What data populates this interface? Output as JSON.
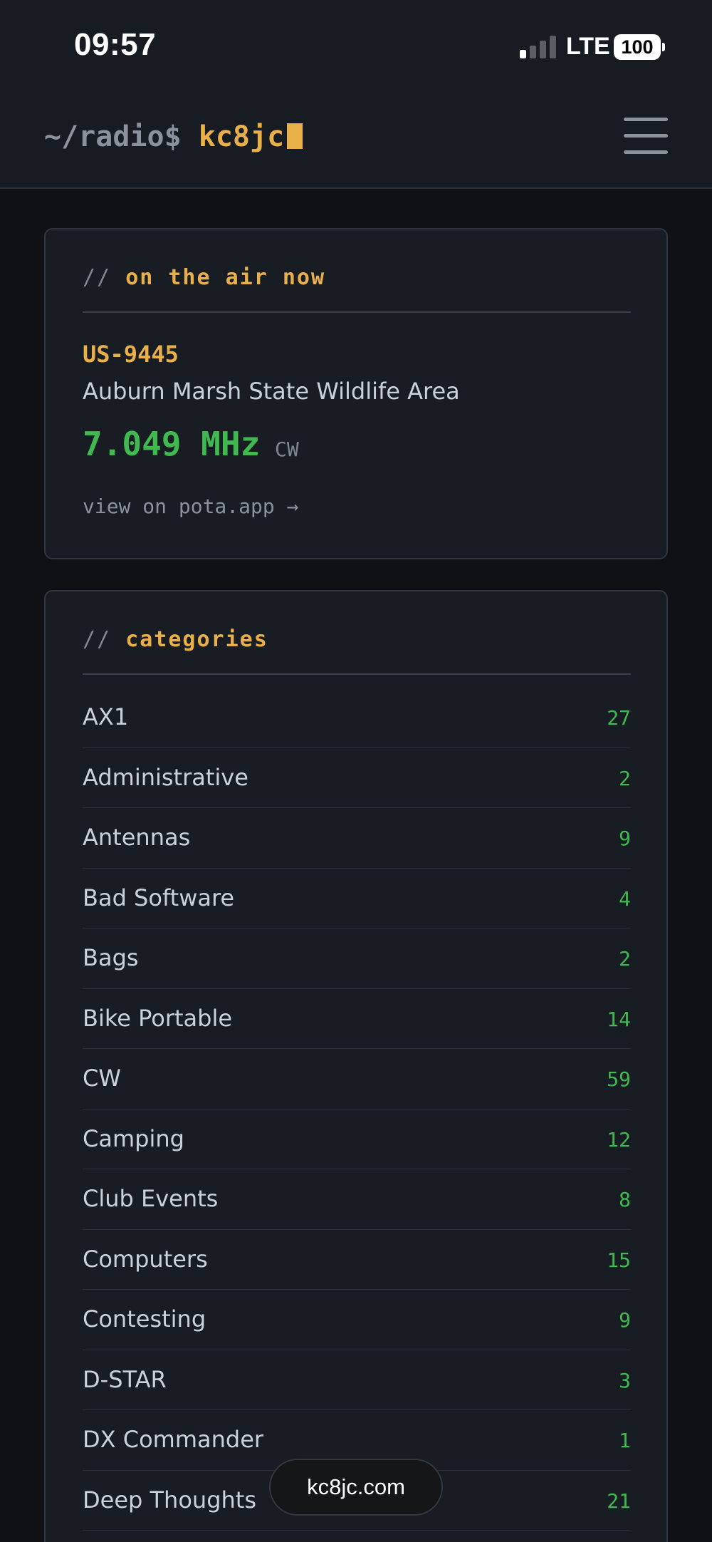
{
  "status_bar": {
    "time": "09:57",
    "network": "LTE",
    "battery": "100",
    "signal_bars_on": 1,
    "signal_bars_total": 4
  },
  "header": {
    "prompt": "~/radio$",
    "host": "kc8jc",
    "menu_icon": "hamburger-menu-icon"
  },
  "on_air": {
    "slashes": "//",
    "title": "on the air now",
    "park_ref": "US-9445",
    "park_name": "Auburn Marsh State Wildlife Area",
    "frequency": "7.049 MHz",
    "mode": "CW",
    "link_text": "view on pota.app →"
  },
  "categories": {
    "slashes": "//",
    "title": "categories",
    "items": [
      {
        "name": "AX1",
        "count": "27"
      },
      {
        "name": "Administrative",
        "count": "2"
      },
      {
        "name": "Antennas",
        "count": "9"
      },
      {
        "name": "Bad Software",
        "count": "4"
      },
      {
        "name": "Bags",
        "count": "2"
      },
      {
        "name": "Bike Portable",
        "count": "14"
      },
      {
        "name": "CW",
        "count": "59"
      },
      {
        "name": "Camping",
        "count": "12"
      },
      {
        "name": "Club Events",
        "count": "8"
      },
      {
        "name": "Computers",
        "count": "15"
      },
      {
        "name": "Contesting",
        "count": "9"
      },
      {
        "name": "D-STAR",
        "count": "3"
      },
      {
        "name": "DX Commander",
        "count": "1"
      },
      {
        "name": "Deep Thoughts",
        "count": "21"
      },
      {
        "name": "",
        "count": ""
      }
    ]
  },
  "browser": {
    "url": "kc8jc.com"
  },
  "colors": {
    "accent_amber": "#e9b04a",
    "accent_green": "#3fb950",
    "background": "#0f1115",
    "card": "#181c23"
  }
}
